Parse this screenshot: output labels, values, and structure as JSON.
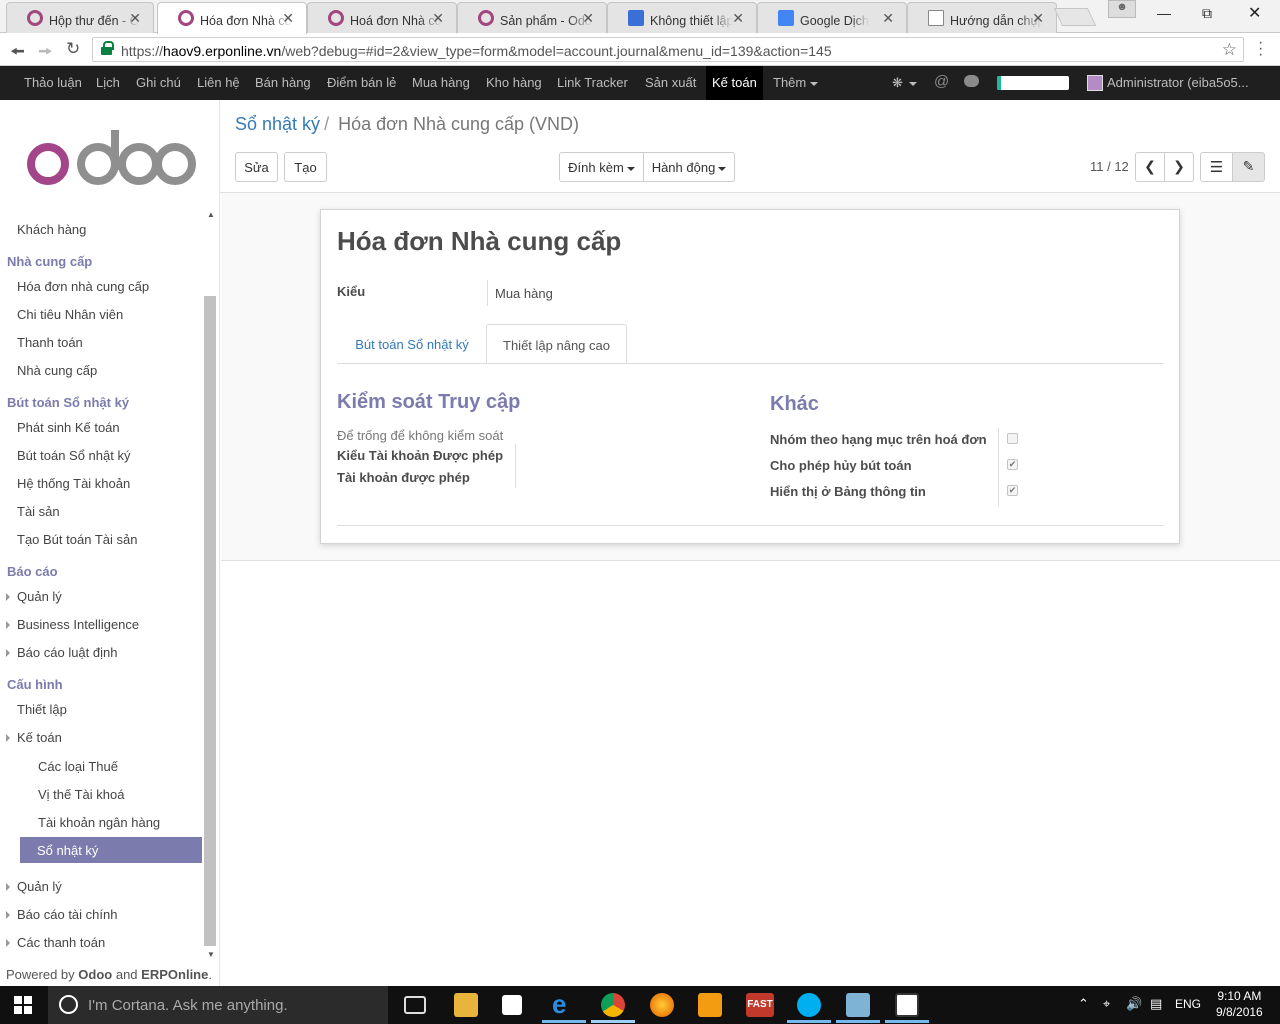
{
  "browser": {
    "tabs": [
      {
        "title": "Hộp thư đến - O",
        "icon": "odoo-circle-icon"
      },
      {
        "title": "Hóa đơn Nhà cu",
        "icon": "odoo-circle-icon",
        "active": true
      },
      {
        "title": "Hoá đơn Nhà cu",
        "icon": "odoo-circle-icon"
      },
      {
        "title": "Sản phẩm - Odo",
        "icon": "odoo-circle-icon"
      },
      {
        "title": "Không thiết lập",
        "icon": "grid-icon"
      },
      {
        "title": "Google Dịch",
        "icon": "google-translate-icon"
      },
      {
        "title": "Hướng dẫn chụp",
        "icon": "document-icon"
      }
    ],
    "url_prefix": "https://",
    "url_host": "haov9.erponline.vn",
    "url_path": "/web?debug=#id=2&view_type=form&model=account.journal&menu_id=139&action=145"
  },
  "topmenu": {
    "items": [
      "Thảo luận",
      "Lịch",
      "Ghi chú",
      "Liên hệ",
      "Bán hàng",
      "Điểm bán lẻ",
      "Mua hàng",
      "Kho hàng",
      "Link Tracker",
      "Sản xuất",
      "Kế toán",
      "Thêm"
    ],
    "active": "Kế toán",
    "progress": 0.05,
    "user": "Administrator (eiba5o5..."
  },
  "sidebar": {
    "entries": [
      {
        "type": "item",
        "label": "Khách hàng"
      },
      {
        "type": "head",
        "label": "Nhà cung cấp"
      },
      {
        "type": "item",
        "label": "Hóa đơn nhà cung cấp"
      },
      {
        "type": "item",
        "label": "Chi tiêu Nhân viên"
      },
      {
        "type": "item",
        "label": "Thanh toán"
      },
      {
        "type": "item",
        "label": "Nhà cung cấp"
      },
      {
        "type": "head",
        "label": "Bút toán Sổ nhật ký"
      },
      {
        "type": "item",
        "label": "Phát sinh Kế toán"
      },
      {
        "type": "item",
        "label": "Bút toán Sổ nhật ký"
      },
      {
        "type": "item",
        "label": "Hệ thống Tài khoản"
      },
      {
        "type": "item",
        "label": "Tài sản"
      },
      {
        "type": "item",
        "label": "Tạo Bút toán Tài sản"
      },
      {
        "type": "head",
        "label": "Báo cáo"
      },
      {
        "type": "folder",
        "label": "Quản lý"
      },
      {
        "type": "folder",
        "label": "Business Intelligence"
      },
      {
        "type": "folder",
        "label": "Báo cáo luật định"
      },
      {
        "type": "head",
        "label": "Cấu hình"
      },
      {
        "type": "item",
        "label": "Thiết lập"
      },
      {
        "type": "folder",
        "label": "Kế toán"
      },
      {
        "type": "sub",
        "label": "Các loại Thuế"
      },
      {
        "type": "sub",
        "label": "Vị thế Tài khoá"
      },
      {
        "type": "sub",
        "label": "Tài khoản ngân hàng"
      },
      {
        "type": "active",
        "label": "Sổ nhật ký"
      },
      {
        "type": "folder",
        "label": "Quản lý"
      },
      {
        "type": "folder",
        "label": "Báo cáo tài chính"
      },
      {
        "type": "folder",
        "label": "Các thanh toán"
      }
    ],
    "powered_by": "Powered by",
    "powered_odoo": "Odoo",
    "powered_and": "and",
    "powered_erp": "ERPOnline",
    "powered_dot": "."
  },
  "control_panel": {
    "breadcrumb_parent": "Sổ nhật ký",
    "breadcrumb_current": "Hóa đơn Nhà cung cấp (VND)",
    "edit_label": "Sửa",
    "create_label": "Tạo",
    "attach_label": "Đính kèm",
    "action_label": "Hành động",
    "pager": "11 / 12"
  },
  "form": {
    "title": "Hóa đơn Nhà cung cấp",
    "type_label": "Kiểu",
    "type_value": "Mua hàng",
    "tab_entries": "Bút toán Sổ nhật ký",
    "tab_advanced": "Thiết lập nâng cao",
    "access_title": "Kiểm soát Truy cập",
    "access_help": "Để trống để không kiểm soát",
    "allowed_types_label": "Kiểu Tài khoản Được phép",
    "allowed_accounts_label": "Tài khoản được phép",
    "other_title": "Khác",
    "other_fields": [
      {
        "label": "Nhóm theo hạng mục trên hoá đơn",
        "checked": false
      },
      {
        "label": "Cho phép hủy bút toán",
        "checked": true
      },
      {
        "label": "Hiển thị ở Bảng thông tin",
        "checked": true
      }
    ]
  },
  "taskbar": {
    "cortana": "I'm Cortana. Ask me anything.",
    "lang": "ENG",
    "time": "9:10 AM",
    "date": "9/8/2016",
    "fast_label": "FAST"
  }
}
